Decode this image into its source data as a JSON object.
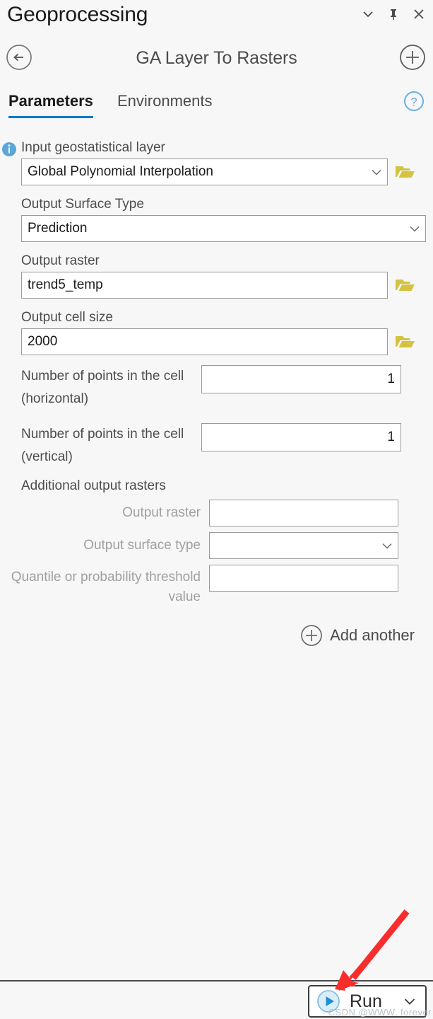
{
  "window": {
    "title": "Geoprocessing",
    "icons": {
      "menu": "chevron-down-icon",
      "pin": "pin-icon",
      "close": "close-icon"
    }
  },
  "header": {
    "back_icon": "back-arrow-icon",
    "tool_title": "GA Layer To Rasters",
    "add_icon": "plus-circle-icon"
  },
  "tabs": {
    "items": [
      {
        "label": "Parameters",
        "active": true
      },
      {
        "label": "Environments",
        "active": false
      }
    ],
    "help_icon": "help-circle-icon"
  },
  "parameters": {
    "input_layer": {
      "label": "Input geostatistical layer",
      "value": "Global Polynomial Interpolation",
      "has_info_icon": true,
      "browse_icon": "folder-open-icon"
    },
    "output_surface_type": {
      "label": "Output Surface Type",
      "value": "Prediction"
    },
    "output_raster": {
      "label": "Output raster",
      "value": "trend5_temp",
      "browse_icon": "folder-open-icon"
    },
    "output_cell_size": {
      "label": "Output cell size",
      "value": "2000",
      "browse_icon": "folder-open-icon"
    },
    "points_horizontal": {
      "label": "Number of points in the cell (horizontal)",
      "value": "1"
    },
    "points_vertical": {
      "label": "Number of points in the cell (vertical)",
      "value": "1"
    }
  },
  "additional_output_rasters": {
    "section_label": "Additional output rasters",
    "rows": [
      {
        "label": "Output raster",
        "value": "",
        "type": "text"
      },
      {
        "label": "Output surface type",
        "value": "",
        "type": "combo"
      },
      {
        "label": "Quantile or probability threshold value",
        "value": "",
        "type": "text"
      }
    ],
    "add_another": {
      "label": "Add another",
      "icon": "plus-circle-icon"
    }
  },
  "footer": {
    "run": {
      "label": "Run",
      "play_icon": "play-circle-icon",
      "chevron_icon": "chevron-down-icon"
    },
    "watermark": "CSDN @WWW. forever"
  },
  "colors": {
    "panel_background": "#f7f7f7",
    "accent_blue": "#0779c4",
    "info_blue": "#5aa7d8",
    "folder_yellow": "#d4c340",
    "annotation_red": "#fa2d2d",
    "border_gray": "#9a9a9a",
    "disabled_label": "#a0a0a0"
  },
  "annotation": {
    "type": "red-arrow",
    "points_to": "Run"
  }
}
